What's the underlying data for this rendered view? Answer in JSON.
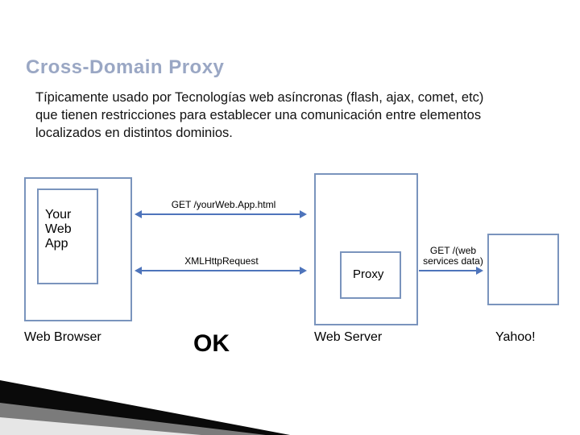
{
  "title": "Cross-Domain Proxy",
  "body": "Típicamente usado por Tecnologías web asíncronas (flash, ajax, comet, etc) que tienen restricciones para establecer una comunicación entre elementos localizados en distintos dominios.",
  "diagram": {
    "browser_box": {
      "inner_label": "Your\nWeb\nApp",
      "caption": "Web Browser"
    },
    "server_box": {
      "inner_label": "Proxy",
      "caption": "Web Server"
    },
    "yahoo_box": {
      "caption": "Yahoo!"
    },
    "links": {
      "get_html": "GET /yourWeb.App.html",
      "xhr": "XMLHttpRequest",
      "get_ws": "GET /(web services data)"
    },
    "ok": "OK"
  }
}
